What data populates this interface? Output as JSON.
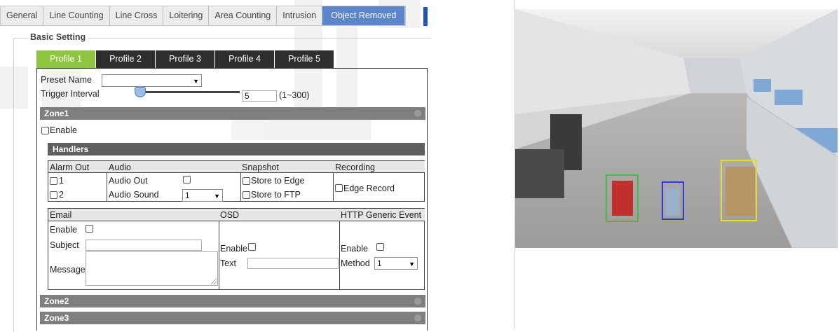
{
  "top_tabs": [
    {
      "label": "General",
      "active": false
    },
    {
      "label": "Line Counting",
      "active": false
    },
    {
      "label": "Line Cross",
      "active": false
    },
    {
      "label": "Loitering",
      "active": false
    },
    {
      "label": "Area Counting",
      "active": false
    },
    {
      "label": "Intrusion",
      "active": false
    },
    {
      "label": "Object Removed",
      "active": true
    }
  ],
  "basic_setting": {
    "legend": "Basic Setting",
    "profile_tabs": [
      {
        "label": "Profile 1",
        "active": true
      },
      {
        "label": "Profile 2",
        "active": false
      },
      {
        "label": "Profile 3",
        "active": false
      },
      {
        "label": "Profile 4",
        "active": false
      },
      {
        "label": "Profile 5",
        "active": false
      }
    ],
    "preset_name": {
      "label": "Preset Name",
      "value": ""
    },
    "trigger_interval": {
      "label": "Trigger Interval",
      "value": "5",
      "range": "(1~300)",
      "slider_level": 0.0
    }
  },
  "zones": {
    "zone1": {
      "title": "Zone1",
      "enable_label": "Enable",
      "handlers_title": "Handlers",
      "alarm_out": {
        "header": "Alarm Out",
        "options": [
          "1",
          "2"
        ]
      },
      "audio": {
        "header": "Audio",
        "audio_out_label": "Audio Out",
        "audio_sound_label": "Audio Sound",
        "audio_sound_value": "1"
      },
      "snapshot": {
        "header": "Snapshot",
        "store_edge": "Store to Edge",
        "store_ftp": "Store to FTP"
      },
      "recording": {
        "header": "Recording",
        "edge_record": "Edge Record"
      },
      "email": {
        "header": "Email",
        "enable_label": "Enable",
        "subject_label": "Subject",
        "subject_value": "",
        "message_label": "Message",
        "message_value": ""
      },
      "osd": {
        "header": "OSD",
        "enable_label": "Enable",
        "text_label": "Text",
        "text_value": ""
      },
      "http": {
        "header": "HTTP Generic Event",
        "enable_label": "Enable",
        "method_label": "Method",
        "method_value": "1"
      }
    },
    "zone2": {
      "title": "Zone2"
    },
    "zone3": {
      "title": "Zone3"
    }
  },
  "camera": {
    "bbox_colors": [
      "#3cbf3c",
      "#2a3fd6",
      "#e6d73a"
    ]
  }
}
